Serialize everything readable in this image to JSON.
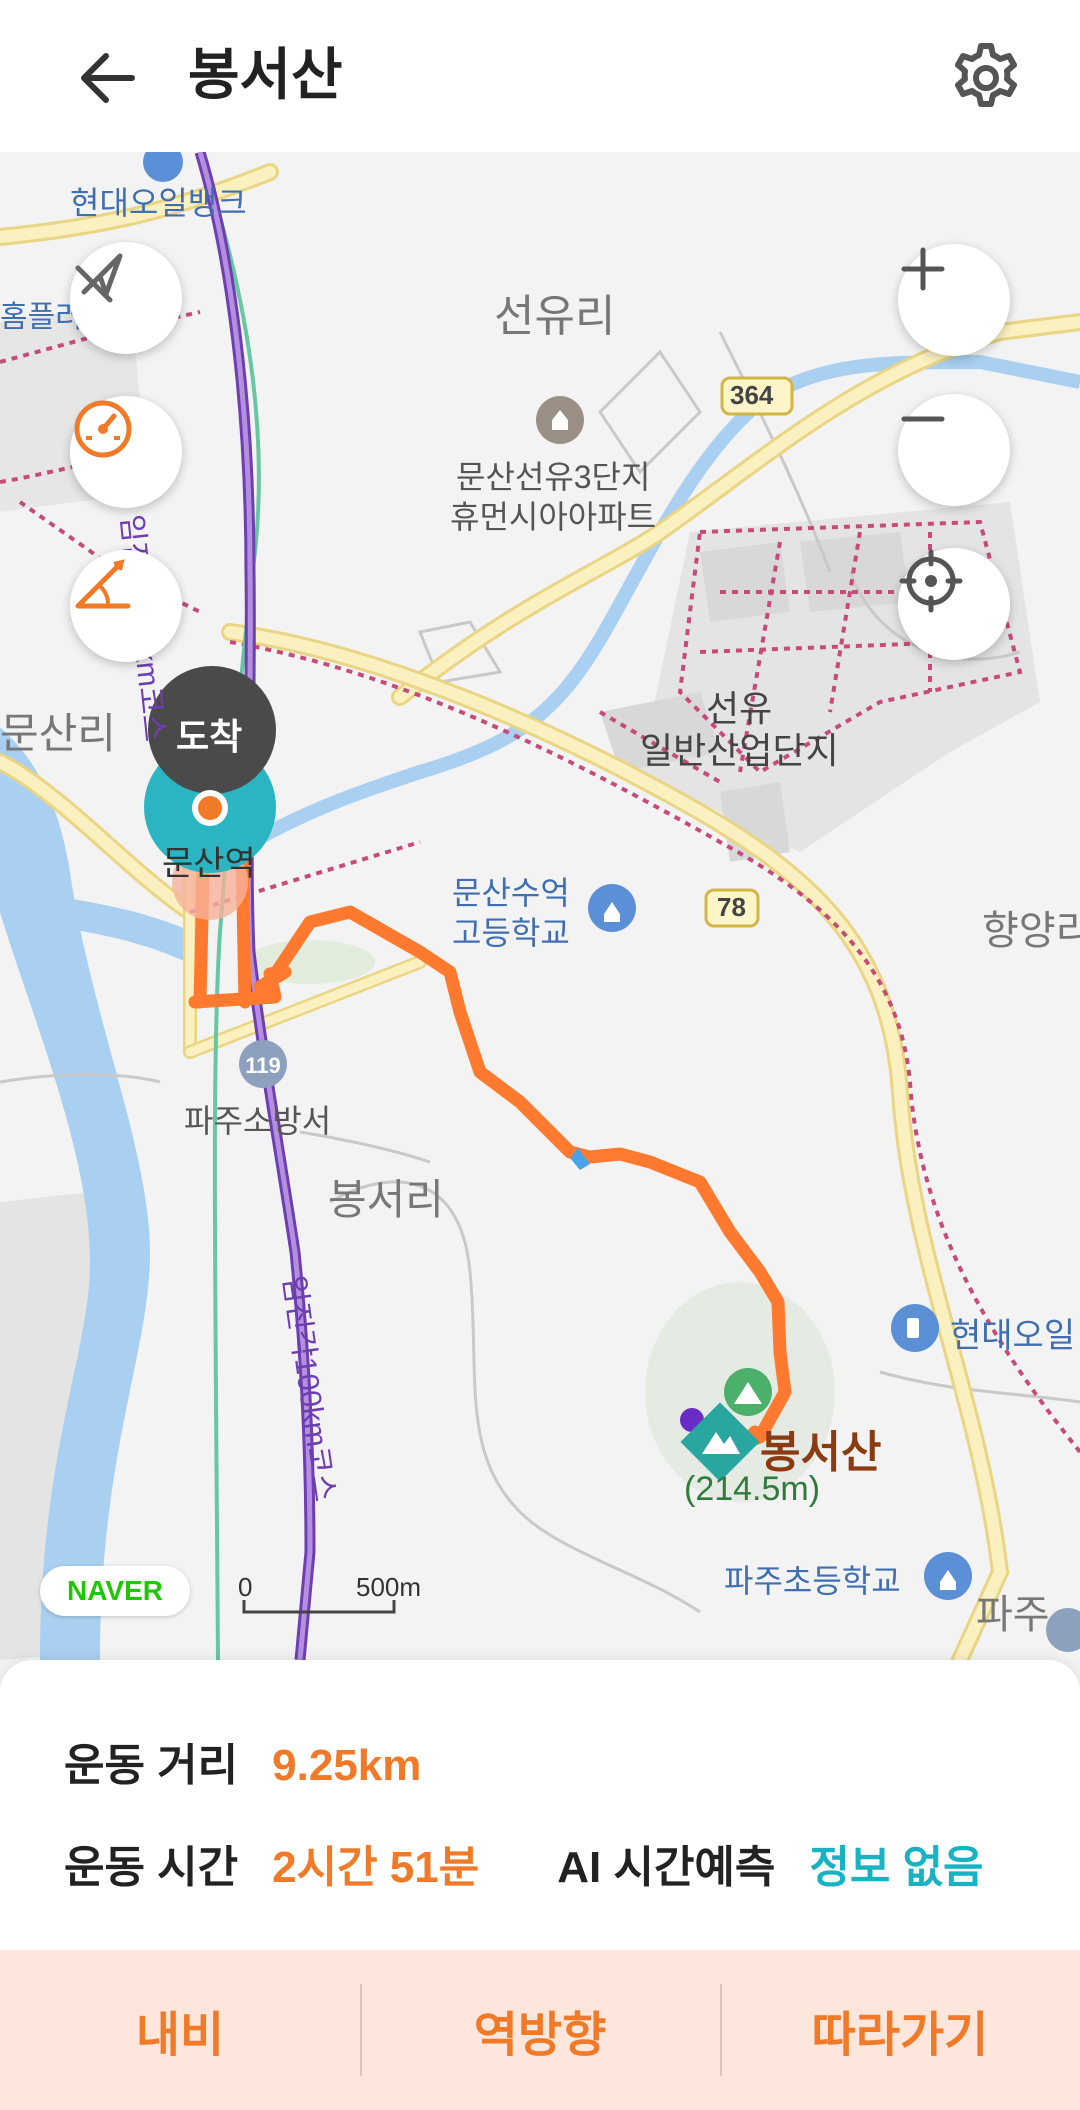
{
  "header": {
    "title": "봉서산",
    "back_icon": "arrow-left-icon",
    "settings_icon": "gear-icon"
  },
  "map": {
    "labels": {
      "hyundai_oilbank_top": "현대오일뱅크",
      "home_plus": "홈플러",
      "seonyu_ri": "선유리",
      "apt_name_1": "문산선유3단지",
      "apt_name_2": "휴먼시아아파트",
      "route_364": "364",
      "route_78": "78",
      "industrial_1": "선유",
      "industrial_2": "일반산업단지",
      "munsan_ri": "문산리",
      "station": "문산역",
      "school_1": "문산수억",
      "school_2": "고등학교",
      "hyangyang": "향양리",
      "fire_station": "파주소방서",
      "bongseo_ri": "봉서리",
      "trail_top": "임진각100km코스",
      "trail_bottom": "임진각100km코스",
      "hyundai_oil_right": "현대오일",
      "peak_name": "봉서산",
      "peak_height": "(214.5m)",
      "elementary": "파주초등학교",
      "paju_right": "파주",
      "arrival_marker": "도착",
      "naver_logo": "NAVER",
      "scale_zero": "0",
      "scale_distance": "500m"
    },
    "controls": {
      "compass_off": "compass-off-icon",
      "speedometer": "speedometer-icon",
      "slope": "slope-angle-icon",
      "zoom_in": "plus-icon",
      "zoom_out": "minus-icon",
      "locate": "crosshair-icon"
    }
  },
  "stats": {
    "distance_label": "운동 거리",
    "distance_value": "9.25km",
    "time_label": "운동 시간",
    "time_value": "2시간 51분",
    "ai_label": "AI 시간예측",
    "ai_value": "정보 없음"
  },
  "actions": {
    "navi": "내비",
    "reverse": "역방향",
    "follow": "따라가기"
  },
  "colors": {
    "accent_orange": "#f07a28",
    "ai_teal": "#17b3c2",
    "action_bar_bg": "#fde7dc",
    "route": "#ff7a2e"
  }
}
